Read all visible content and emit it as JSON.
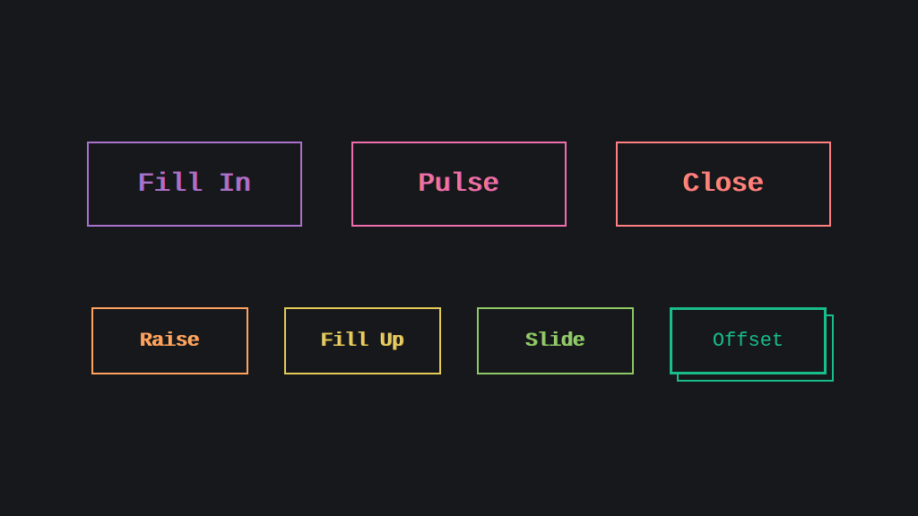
{
  "buttons": {
    "top": [
      {
        "label": "Fill In",
        "variant": "fill-in"
      },
      {
        "label": "Pulse",
        "variant": "pulse"
      },
      {
        "label": "Close",
        "variant": "close"
      }
    ],
    "bottom": [
      {
        "label": "Raise",
        "variant": "raise"
      },
      {
        "label": "Fill Up",
        "variant": "fill-up"
      },
      {
        "label": "Slide",
        "variant": "slide"
      },
      {
        "label": "Offset",
        "variant": "offset"
      }
    ]
  },
  "colors": {
    "background": "#17181c",
    "fill_in": "#a972cb",
    "pulse": "#ef6eae",
    "close": "#ff7f82",
    "raise": "#ffa260",
    "fill_up": "#e4cb58",
    "slide": "#8fc866",
    "offset": "#19bc8b"
  }
}
